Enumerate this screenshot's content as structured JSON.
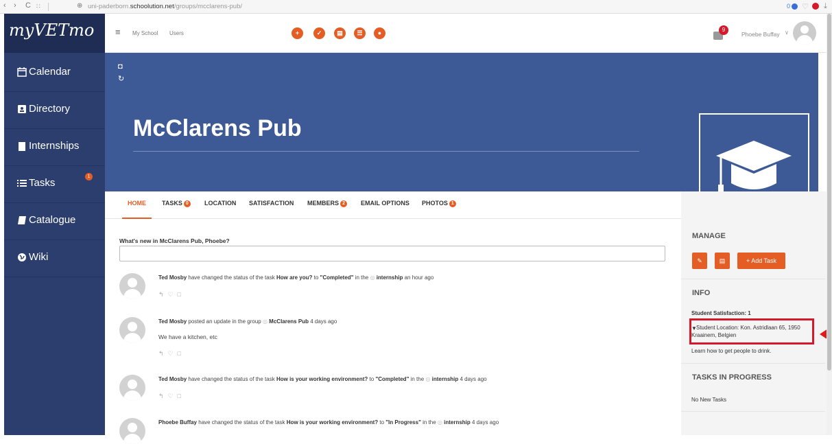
{
  "browser": {
    "url_prefix": "uni-paderborn.",
    "url_domain": "schoolution.net",
    "url_path": "/groups/mcclarens-pub/",
    "ext_count": "0"
  },
  "app": {
    "logo_text": "myVETmo"
  },
  "sidebar": {
    "items": [
      {
        "label": "Calendar",
        "icon": "calendar-icon"
      },
      {
        "label": "Directory",
        "icon": "address-book-icon"
      },
      {
        "label": "Internships",
        "icon": "building-icon"
      },
      {
        "label": "Tasks",
        "icon": "list-icon",
        "badge": "1"
      },
      {
        "label": "Catalogue",
        "icon": "book-icon"
      },
      {
        "label": "Wiki",
        "icon": "globe-icon"
      }
    ]
  },
  "topbar": {
    "menu_items": [
      "My School",
      "Users"
    ],
    "notifications_count": "9",
    "user_name": "Phoebe Buffay"
  },
  "group": {
    "title": "McClarens Pub"
  },
  "tabs": [
    {
      "label": "HOME"
    },
    {
      "label": "TASKS",
      "badge": "0"
    },
    {
      "label": "LOCATION"
    },
    {
      "label": "SATISFACTION"
    },
    {
      "label": "MEMBERS",
      "badge": "2"
    },
    {
      "label": "EMAIL OPTIONS"
    },
    {
      "label": "PHOTOS",
      "badge": "1"
    }
  ],
  "whatsnew": {
    "prompt": "What's new in McClarens Pub, Phoebe?"
  },
  "activity": [
    {
      "actor": "Ted Mosby",
      "pre": " have changed the status of the task ",
      "task": "How are you?",
      "mid": " to ",
      "status": "\"Completed\"",
      "in": " in the ",
      "group": "internship",
      "time": " an hour ago",
      "body": ""
    },
    {
      "actor": "Ted Mosby",
      "pre": " posted an update in the group ",
      "task": "",
      "mid": "",
      "status": "",
      "in": "",
      "group": "McClarens Pub",
      "time": " 4 days ago",
      "body": "We have a kitchen, etc"
    },
    {
      "actor": "Ted Mosby",
      "pre": " have changed the status of the task ",
      "task": "How is your working environment?",
      "mid": " to ",
      "status": "\"Completed\"",
      "in": " in the ",
      "group": "internship",
      "time": " 4 days ago",
      "body": ""
    },
    {
      "actor": "Phoebe Buffay",
      "pre": " have changed the status of the task ",
      "task": "How is your working environment?",
      "mid": " to ",
      "status": "\"In Progress\"",
      "in": " in the ",
      "group": "internship",
      "time": " 4 days ago",
      "body": ""
    }
  ],
  "right": {
    "manage_title": "MANAGE",
    "add_task_label": "+ Add Task",
    "info_title": "INFO",
    "satisfaction": "Student Satisfaction: 1",
    "location_line1": "Student Location: Kon. Astridlaan 65, 1950",
    "location_line2": "Kraainem, Belgien",
    "tagline": "Learn how to get people to drink.",
    "tasks_title": "TASKS IN PROGRESS",
    "tasks_empty": "No New Tasks"
  },
  "colors": {
    "accent": "#e35d25",
    "sidebar": "#2c3e6e",
    "banner": "#3d5a96",
    "highlight": "#d3192a"
  }
}
